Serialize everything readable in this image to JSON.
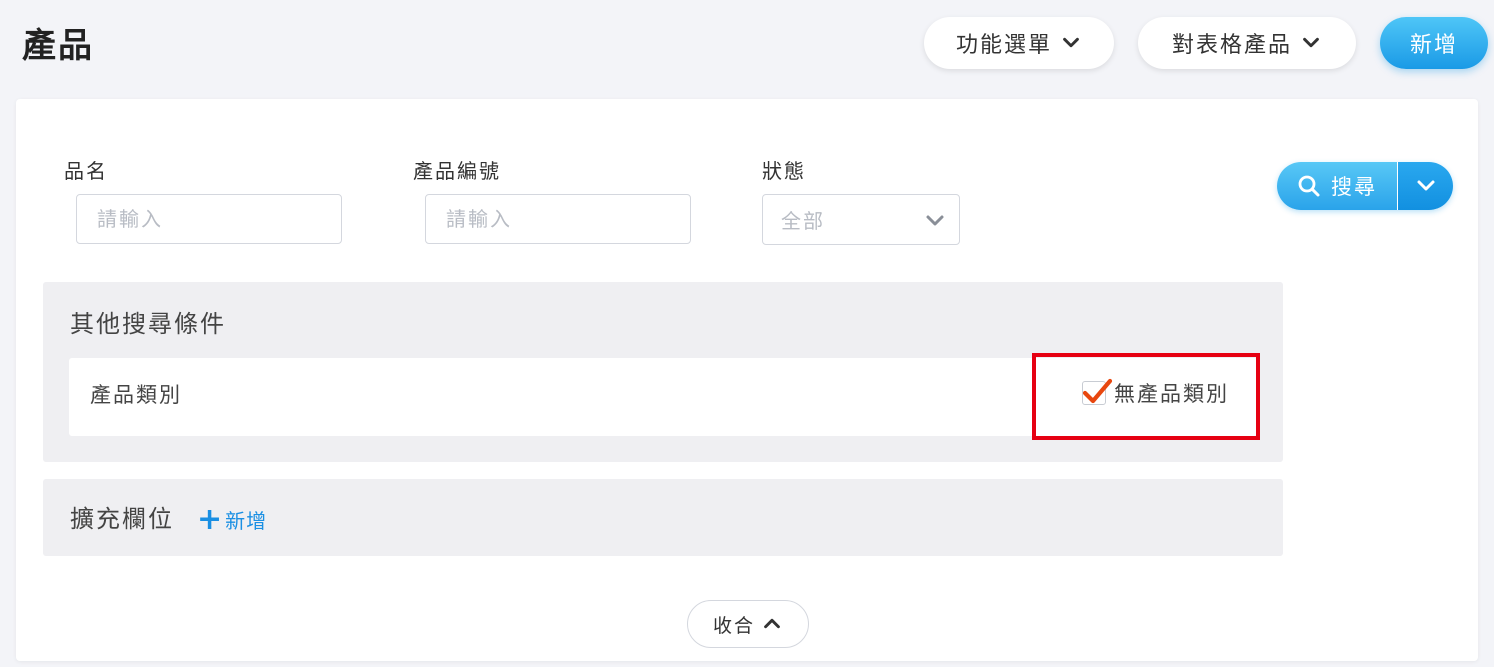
{
  "header": {
    "title": "產品",
    "function_menu_label": "功能選單",
    "table_menu_label": "對表格產品",
    "add_label": "新增"
  },
  "filters": {
    "name": {
      "label": "品名",
      "placeholder": "請輸入",
      "value": ""
    },
    "product_code": {
      "label": "產品編號",
      "placeholder": "請輸入",
      "value": ""
    },
    "status": {
      "label": "狀態",
      "selected": "全部"
    },
    "search_label": "搜尋"
  },
  "other_conditions": {
    "title": "其他搜尋條件",
    "category_label": "產品類別",
    "no_category_checkbox": {
      "label": "無產品類別",
      "checked": true
    }
  },
  "extension": {
    "title": "擴充欄位",
    "add_label": "新增"
  },
  "collapse_label": "收合",
  "colors": {
    "accent_blue": "#1a9ae6",
    "highlight_red": "#e60012",
    "check_orange": "#e8470f"
  }
}
